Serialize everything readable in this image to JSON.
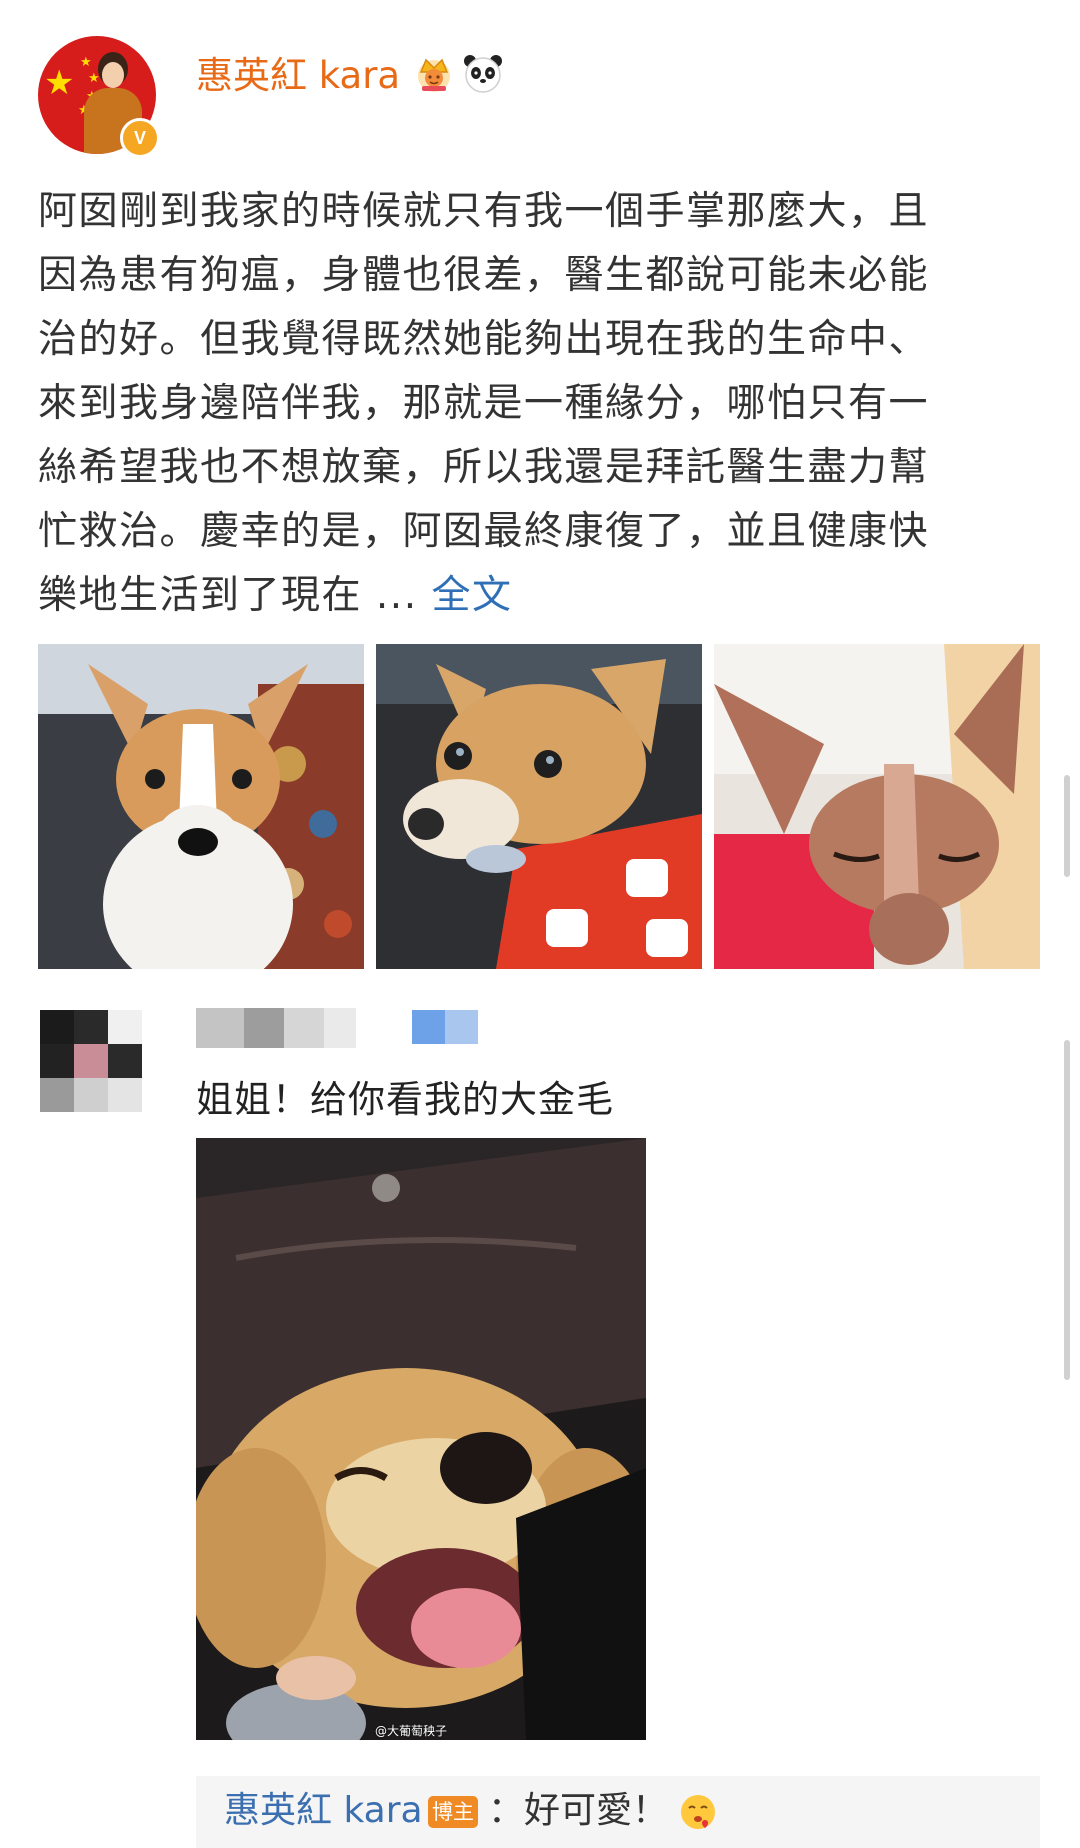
{
  "post": {
    "author": "惠英紅 kara",
    "author_icons": [
      "crown-icon",
      "panda-icon"
    ],
    "verified_badge": "V",
    "text_lines": [
      "阿囡剛到我家的時候就只有我一個手掌那麼大，且",
      "因為患有狗瘟，身體也很差，醫生都說可能未必能",
      "治的好。但我覺得既然她能夠出現在我的生命中、",
      "來到我身邊陪伴我，那就是一種緣分，哪怕只有一",
      "絲希望我也不想放棄，所以我還是拜託醫生盡力幫",
      "忙救治。慶幸的是，阿囡最終康復了，並且健康快",
      "樂地生活到了現在 ..."
    ],
    "fulltext_link": "全文",
    "photos": [
      "dog-photo-1",
      "dog-photo-2",
      "dog-photo-3"
    ]
  },
  "comment": {
    "text": "姐姐！给你看我的大金毛",
    "image": "golden-retriever-photo",
    "watermark": "@大葡萄秧子"
  },
  "author_reply": {
    "author": "惠英紅 kara",
    "tag": "博主",
    "text": "：好可愛！",
    "emoji": "heart-face-emoji"
  },
  "colors": {
    "author_name": "#e86a17",
    "link": "#2f6fb6",
    "reply_author": "#3b6fb0",
    "tag": "#f08a24"
  }
}
